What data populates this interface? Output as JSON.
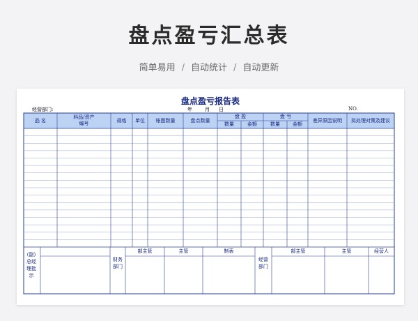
{
  "banner": {
    "title": "盘点盈亏汇总表",
    "tags": [
      "简单易用",
      "自动统计",
      "自动更新"
    ],
    "separator": "/"
  },
  "form": {
    "title": "盘点盈亏报告表",
    "dept_label": "经营部门:",
    "year": "年",
    "month": "月",
    "day": "日",
    "no_label": "NO.",
    "columns": {
      "name": "品  名",
      "code_line1": "料品/资产",
      "code_line2": "编号",
      "spec": "规格",
      "unit": "单位",
      "book_qty": "帐面数量",
      "count_qty": "盘点数量",
      "gain": "盘  盈",
      "loss": "盘  亏",
      "qty": "数量",
      "amount": "金额",
      "reason": "差异原因说明",
      "measure": "拟处理对策及建议"
    },
    "footer": {
      "approval": "(副)总经理批示",
      "finance": "财务部门",
      "operating": "经营部门",
      "dept_supervisor": "部主管",
      "supervisor": "主管",
      "prepared": "制表",
      "handler": "经营人"
    }
  }
}
